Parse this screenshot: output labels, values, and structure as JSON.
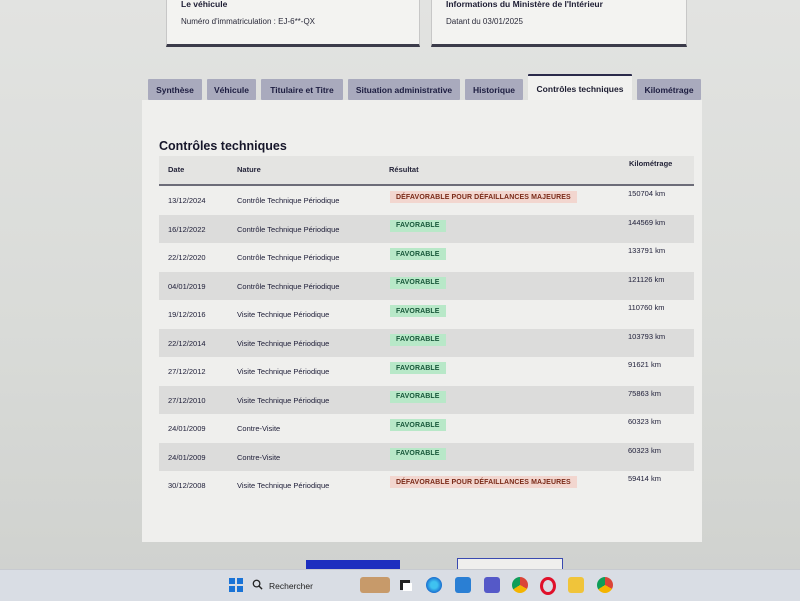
{
  "cards": {
    "left": {
      "title": "Le véhicule",
      "line": "Numéro d'immatriculation : EJ-6**-QX"
    },
    "right": {
      "title": "Informations du Ministère de l'Intérieur",
      "line": "Datant du 03/01/2025"
    }
  },
  "tabs": [
    {
      "label": "Synthèse",
      "active": false
    },
    {
      "label": "Véhicule",
      "active": false
    },
    {
      "label": "Titulaire et Titre",
      "active": false
    },
    {
      "label": "Situation administrative",
      "active": false
    },
    {
      "label": "Historique",
      "active": false
    },
    {
      "label": "Contrôles techniques",
      "active": true
    },
    {
      "label": "Kilométrage",
      "active": false
    }
  ],
  "section": {
    "title": "Contrôles techniques",
    "columns": {
      "date": "Date",
      "nature": "Nature",
      "result": "Résultat",
      "km": "Kilométrage"
    },
    "rows": [
      {
        "date": "13/12/2024",
        "nature": "Contrôle Technique Périodique",
        "result": "DÉFAVORABLE POUR DÉFAILLANCES MAJEURES",
        "status": "defavorable",
        "km": "150704 km"
      },
      {
        "date": "16/12/2022",
        "nature": "Contrôle Technique Périodique",
        "result": "FAVORABLE",
        "status": "favorable",
        "km": "144569 km"
      },
      {
        "date": "22/12/2020",
        "nature": "Contrôle Technique Périodique",
        "result": "FAVORABLE",
        "status": "favorable",
        "km": "133791 km"
      },
      {
        "date": "04/01/2019",
        "nature": "Contrôle Technique Périodique",
        "result": "FAVORABLE",
        "status": "favorable",
        "km": "121126 km"
      },
      {
        "date": "19/12/2016",
        "nature": "Visite Technique Périodique",
        "result": "FAVORABLE",
        "status": "favorable",
        "km": "110760 km"
      },
      {
        "date": "22/12/2014",
        "nature": "Visite Technique Périodique",
        "result": "FAVORABLE",
        "status": "favorable",
        "km": "103793 km"
      },
      {
        "date": "27/12/2012",
        "nature": "Visite Technique Périodique",
        "result": "FAVORABLE",
        "status": "favorable",
        "km": "91621 km"
      },
      {
        "date": "27/12/2010",
        "nature": "Visite Technique Périodique",
        "result": "FAVORABLE",
        "status": "favorable",
        "km": "75863 km"
      },
      {
        "date": "24/01/2009",
        "nature": "Contre-Visite",
        "result": "FAVORABLE",
        "status": "favorable",
        "km": "60323 km"
      },
      {
        "date": "24/01/2009",
        "nature": "Contre-Visite",
        "result": "FAVORABLE",
        "status": "favorable",
        "km": "60323 km"
      },
      {
        "date": "30/12/2008",
        "nature": "Visite Technique Périodique",
        "result": "DÉFAVORABLE POUR DÉFAILLANCES MAJEURES",
        "status": "defavorable",
        "km": "59414 km"
      }
    ]
  },
  "taskbar": {
    "search_placeholder": "Rechercher",
    "icons": [
      "windows-start-icon",
      "search-icon",
      "widgets-icon",
      "task-view-icon",
      "edge-icon",
      "store-icon",
      "teams-icon",
      "chrome-icon",
      "opera-icon",
      "file-explorer-icon",
      "chrome-badge-icon"
    ]
  }
}
